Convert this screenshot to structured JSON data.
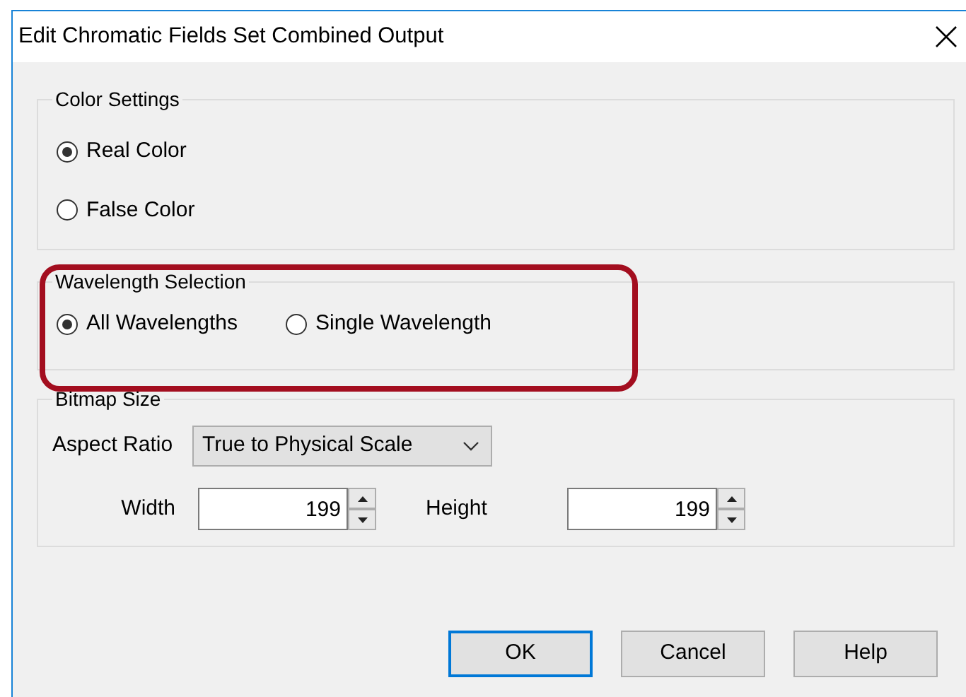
{
  "window": {
    "title": "Edit Chromatic Fields Set Combined Output"
  },
  "groups": [
    {
      "legend": "Color Settings",
      "kind": "radio-column",
      "highlighted": false,
      "options": [
        {
          "label": "Real Color",
          "selected": true
        },
        {
          "label": "False Color",
          "selected": false
        }
      ]
    },
    {
      "legend": "Wavelength Selection",
      "kind": "radio-row",
      "highlighted": true,
      "options": [
        {
          "label": "All Wavelengths",
          "selected": true
        },
        {
          "label": "Single Wavelength",
          "selected": false
        }
      ]
    },
    {
      "legend": "Bitmap Size",
      "kind": "size",
      "highlighted": false,
      "aspect": {
        "label": "Aspect Ratio",
        "value": "True to Physical Scale"
      },
      "fields": [
        {
          "label": "Width",
          "value": "199"
        },
        {
          "label": "Height",
          "value": "199"
        }
      ]
    }
  ],
  "buttons": [
    {
      "label": "OK",
      "default": true
    },
    {
      "label": "Cancel",
      "default": false
    },
    {
      "label": "Help",
      "default": false
    }
  ]
}
